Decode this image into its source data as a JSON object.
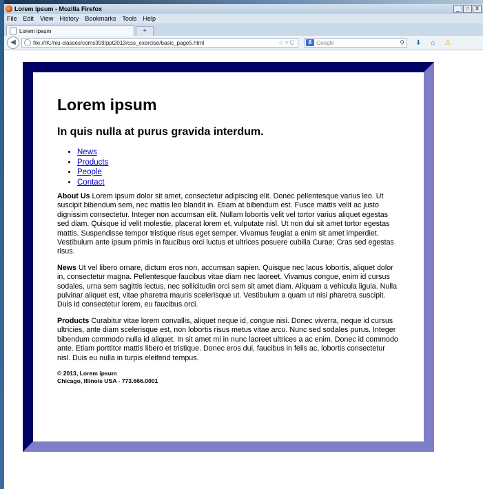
{
  "window": {
    "title": "Lorem ipsum - Mozilla Firefox",
    "controls": [
      "_",
      "□",
      "X"
    ]
  },
  "menu": {
    "items": [
      "File",
      "Edit",
      "View",
      "History",
      "Bookmarks",
      "Tools",
      "Help"
    ]
  },
  "tabs": {
    "active_label": "Lorem ipsum",
    "new_tab_symbol": "+"
  },
  "navbar": {
    "url": "file:///K:/niu-classes/coms359/ppt2013/css_exercise/basic_page5.html",
    "search_placeholder": "Google",
    "search_engine_badge": "8"
  },
  "page": {
    "heading": "Lorem ipsum",
    "subheading": "In quis nulla at purus gravida interdum.",
    "nav_links": [
      "News",
      "Products",
      "People",
      "Contact"
    ],
    "about_label": "About Us",
    "about_text": "Lorem ipsum dolor sit amet, consectetur adipiscing elit. Donec pellentesque varius leo. Ut suscipit bibendum sem, nec mattis leo blandit in. Etiam at bibendum est. Fusce mattis velit ac justo dignissim consectetur. Integer non accumsan elit. Nullam lobortis velit vel tortor varius aliquet egestas sed diam. Quisque id velit molestie, placerat lorem et, vulputate nisl. Ut non dui sit amet tortor egestas mattis. Suspendisse tempor tristique risus eget semper. Vivamus feugiat a enim sit amet imperdiet. Vestibulum ante ipsum primis in faucibus orci luctus et ultrices posuere cubilia Curae; Cras sed egestas risus.",
    "news_label": "News",
    "news_text": "Ut vel libero ornare, dictum eros non, accumsan sapien. Quisque nec lacus lobortis, aliquet dolor in, consectetur magna. Pellentesque faucibus vitae diam nec laoreet. Vivamus congue, enim id cursus sodales, urna sem sagittis lectus, nec sollicitudin orci sem sit amet diam. Aliquam a vehicula ligula. Nulla pulvinar aliquet est, vitae pharetra mauris scelerisque ut. Vestibulum a quam ut nisi pharetra suscipit. Duis id consectetur lorem, eu faucibus orci.",
    "products_label": "Products",
    "products_text": "Curabitur vitae lorem convallis, aliquet neque id, congue nisi. Donec viverra, neque id cursus ultricies, ante diam scelerisque est, non lobortis risus metus vitae arcu. Nunc sed sodales purus. Integer bibendum commodo nulla id aliquet. In sit amet mi in nunc laoreet ultrices a ac enim. Donec id commodo ante. Etiam porttitor mattis libero et tristique. Donec eros dui, faucibus in felis ac, lobortis consectetur nisl. Duis eu nulla in turpis eleifend tempus.",
    "footer_line1": "© 2013, Lorem ipsum",
    "footer_line2": "Chicago, Illinois USA - 773.666.0001"
  },
  "colors": {
    "frame_dark": "#000066",
    "frame_light": "#7f7fc8",
    "link": "#0000cc"
  }
}
